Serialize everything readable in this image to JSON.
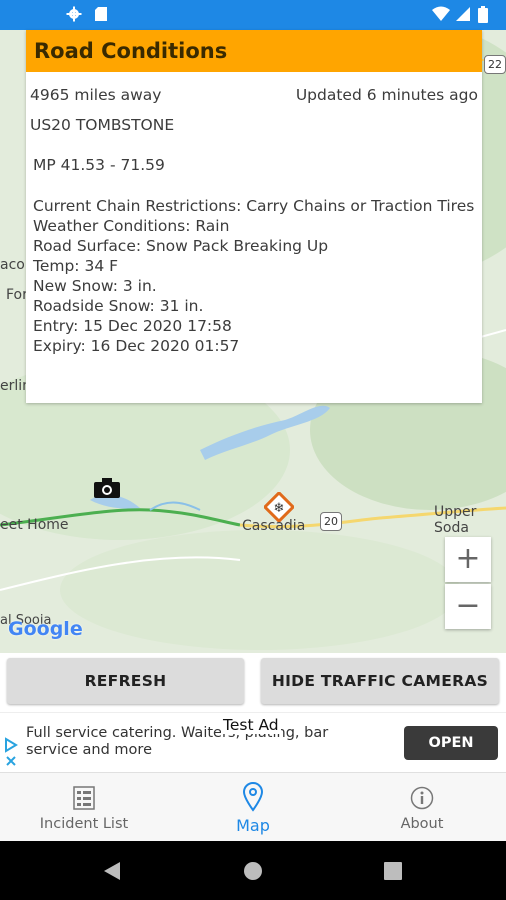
{
  "status_bar": {
    "icons": [
      "gear-icon",
      "sd-card-icon",
      "wifi-icon",
      "signal-icon",
      "battery-icon"
    ]
  },
  "map": {
    "labels": [
      "acor",
      "For",
      "erlin",
      "eet Home",
      "Cascadia",
      "Upper Soda",
      "al Sooia"
    ],
    "route_shields": [
      "22",
      "20"
    ],
    "logo": "Google",
    "zoom_in": "+",
    "zoom_out": "−"
  },
  "popup": {
    "title": "Road Conditions",
    "distance": "4965 miles away",
    "updated": "Updated 6 minutes ago",
    "road_name": "US20 TOMBSTONE",
    "milepost": "MP 41.53 - 71.59",
    "details": [
      "Current Chain Restrictions: Carry Chains or Traction Tires",
      "Weather Conditions: Rain",
      "Road Surface: Snow Pack Breaking Up",
      "Temp: 34 F",
      "New Snow: 3 in.",
      "Roadside Snow: 31 in.",
      "Entry: 15 Dec 2020 17:58",
      "Expiry: 16 Dec 2020 01:57"
    ]
  },
  "buttons": {
    "refresh": "REFRESH",
    "hide_cameras": "HIDE TRAFFIC CAMERAS"
  },
  "ad": {
    "label": "Test Ad",
    "text": "Full service catering. Waiters, plating, bar service and more",
    "cta": "OPEN"
  },
  "tabs": [
    {
      "label": "Incident List",
      "icon": "list-icon",
      "active": false
    },
    {
      "label": "Map",
      "icon": "map-pin-icon",
      "active": true
    },
    {
      "label": "About",
      "icon": "info-icon",
      "active": false
    }
  ],
  "colors": {
    "status_bar": "#1e88e5",
    "popup_header": "#ffa500",
    "active_tab": "#1e88e5"
  }
}
